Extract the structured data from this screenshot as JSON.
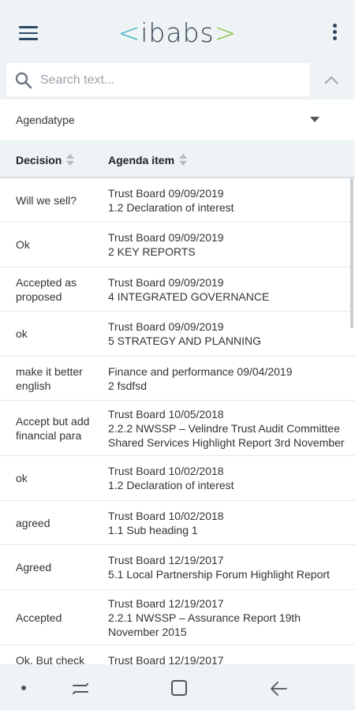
{
  "app_bar": {
    "logo_left": "<",
    "logo_text": "ibabs",
    "logo_right": ">"
  },
  "search": {
    "placeholder": "Search text..."
  },
  "filter": {
    "label": "Agendatype"
  },
  "table": {
    "headers": {
      "decision": "Decision",
      "agenda_item": "Agenda item"
    },
    "rows": [
      {
        "decision": "Will we sell?",
        "meeting": "Trust Board 09/09/2019",
        "item": "1.2 Declaration of interest",
        "item2": ""
      },
      {
        "decision": "Ok",
        "meeting": "Trust Board 09/09/2019",
        "item": "2 KEY REPORTS",
        "item2": ""
      },
      {
        "decision": "Accepted as proposed",
        "meeting": "Trust Board 09/09/2019",
        "item": "4 INTEGRATED GOVERNANCE",
        "item2": ""
      },
      {
        "decision": "ok",
        "meeting": "Trust Board 09/09/2019",
        "item": "5 STRATEGY AND PLANNING",
        "item2": ""
      },
      {
        "decision": "make it better english",
        "meeting": "Finance and performance 09/04/2019",
        "item": "2 fsdfsd",
        "item2": ""
      },
      {
        "decision": "Accept but add financial para",
        "meeting": "Trust Board 10/05/2018",
        "item": "2.2.2 NWSSP – Velindre Trust Audit Committee",
        "item2": "Shared Services Highlight Report 3rd November"
      },
      {
        "decision": "ok",
        "meeting": "Trust Board 10/02/2018",
        "item": "1.2 Declaration of interest",
        "item2": ""
      },
      {
        "decision": "agreed",
        "meeting": "Trust Board 10/02/2018",
        "item": "1.1 Sub heading 1",
        "item2": ""
      },
      {
        "decision": "Agreed",
        "meeting": "Trust Board 12/19/2017",
        "item": "5.1 Local Partnership Forum Highlight Report",
        "item2": ""
      },
      {
        "decision": "Accepted",
        "meeting": "Trust Board 12/19/2017",
        "item": "2.2.1 NWSSP – Assurance Report 19th November 2015",
        "item2": ""
      },
      {
        "decision": "Ok. But check",
        "meeting": "Trust Board 12/19/2017",
        "item": "",
        "item2": ""
      }
    ]
  },
  "icons": {
    "menu": "hamburger-menu-icon",
    "more": "more-vertical-icon",
    "search": "search-icon",
    "collapse": "chevron-up-icon",
    "dropdown": "caret-down-icon",
    "nav_recent": "recent-apps-icon",
    "nav_home": "home-icon",
    "nav_back": "back-arrow-icon"
  }
}
